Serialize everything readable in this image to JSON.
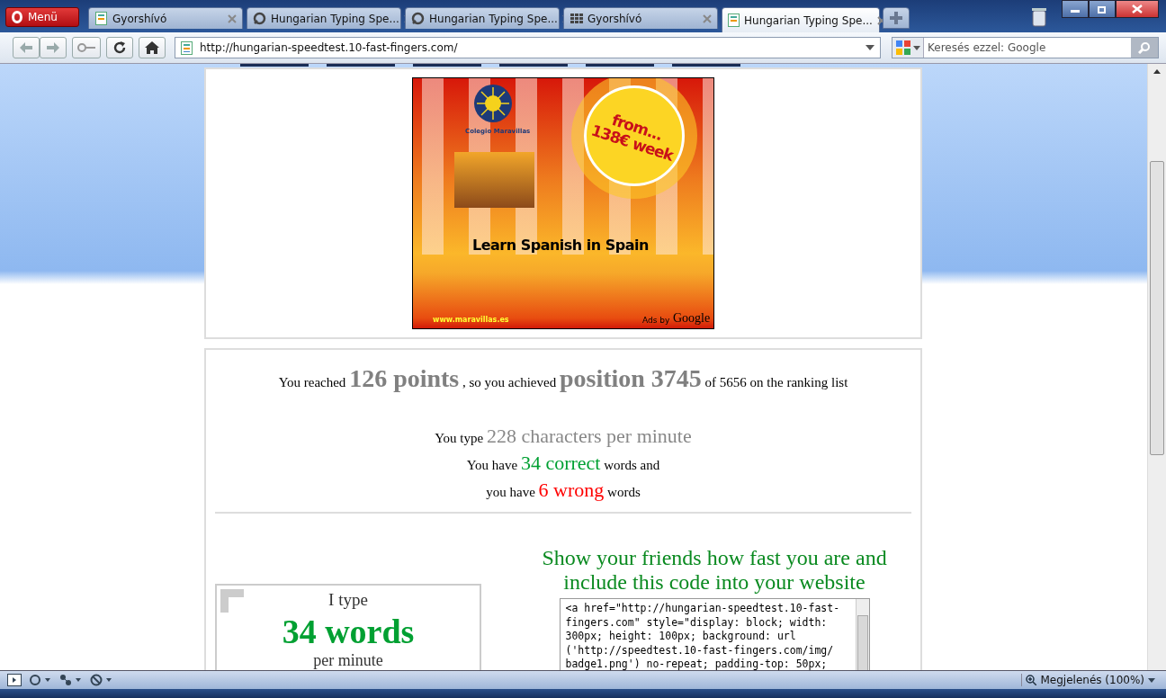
{
  "menu_button": {
    "label": "Menü"
  },
  "tabs": [
    {
      "title": "Gyorshívó",
      "kind": "page",
      "selected": false
    },
    {
      "title": "Hungarian Typing Spe...",
      "kind": "loading",
      "selected": false
    },
    {
      "title": "Hungarian Typing Spe...",
      "kind": "loading",
      "selected": false
    },
    {
      "title": "Gyorshívó",
      "kind": "dial",
      "selected": false
    },
    {
      "title": "Hungarian Typing Spe...",
      "kind": "page",
      "selected": true
    }
  ],
  "address_bar": {
    "url": "http://hungarian-speedtest.10-fast-fingers.com/"
  },
  "search_field": {
    "placeholder": "Keresés ezzel: Google"
  },
  "ad": {
    "logo_caption": "Colegio Maravillas",
    "price": "from...\n138€ week",
    "headline": "Learn Spanish in Spain",
    "url": "www.maravillas.es",
    "ads_by": "Ads by",
    "ads_brand": "Google"
  },
  "results": {
    "points_line": [
      {
        "text": "You reached ",
        "kind": "plain"
      },
      {
        "text": "126 points",
        "kind": "big"
      },
      {
        "text": " , so you achieved ",
        "kind": "plain"
      },
      {
        "text": "position 3745",
        "kind": "big"
      },
      {
        "text": " of 5656 on the ranking list",
        "kind": "plain"
      }
    ],
    "speed_lines": [
      [
        {
          "text": "You type ",
          "kind": "plain"
        },
        {
          "text": "228 characters per minute",
          "kind": "grey"
        }
      ],
      [
        {
          "text": "You have ",
          "kind": "plain"
        },
        {
          "text": "34 correct",
          "kind": "good"
        },
        {
          "text": " words and",
          "kind": "plain"
        }
      ],
      [
        {
          "text": "you have ",
          "kind": "plain"
        },
        {
          "text": "6 wrong",
          "kind": "bad"
        },
        {
          "text": " words",
          "kind": "plain"
        }
      ]
    ]
  },
  "badge": {
    "intro": "I type",
    "words": "34 words",
    "unit": "per minute"
  },
  "share": {
    "heading": "Show your friends how fast you are and include this code into your website",
    "code_lines": [
      "<a href=\"http://hungarian-speedtest.10-fast-",
      "fingers.com\" style=\"display: block; width:",
      "300px; height: 100px; background: url",
      "('http://speedtest.10-fast-fingers.com/img/",
      "badge1.png') no-repeat; padding-top: 50px;"
    ]
  },
  "status_bar": {
    "zoom": "Megjelenés (100%)"
  }
}
